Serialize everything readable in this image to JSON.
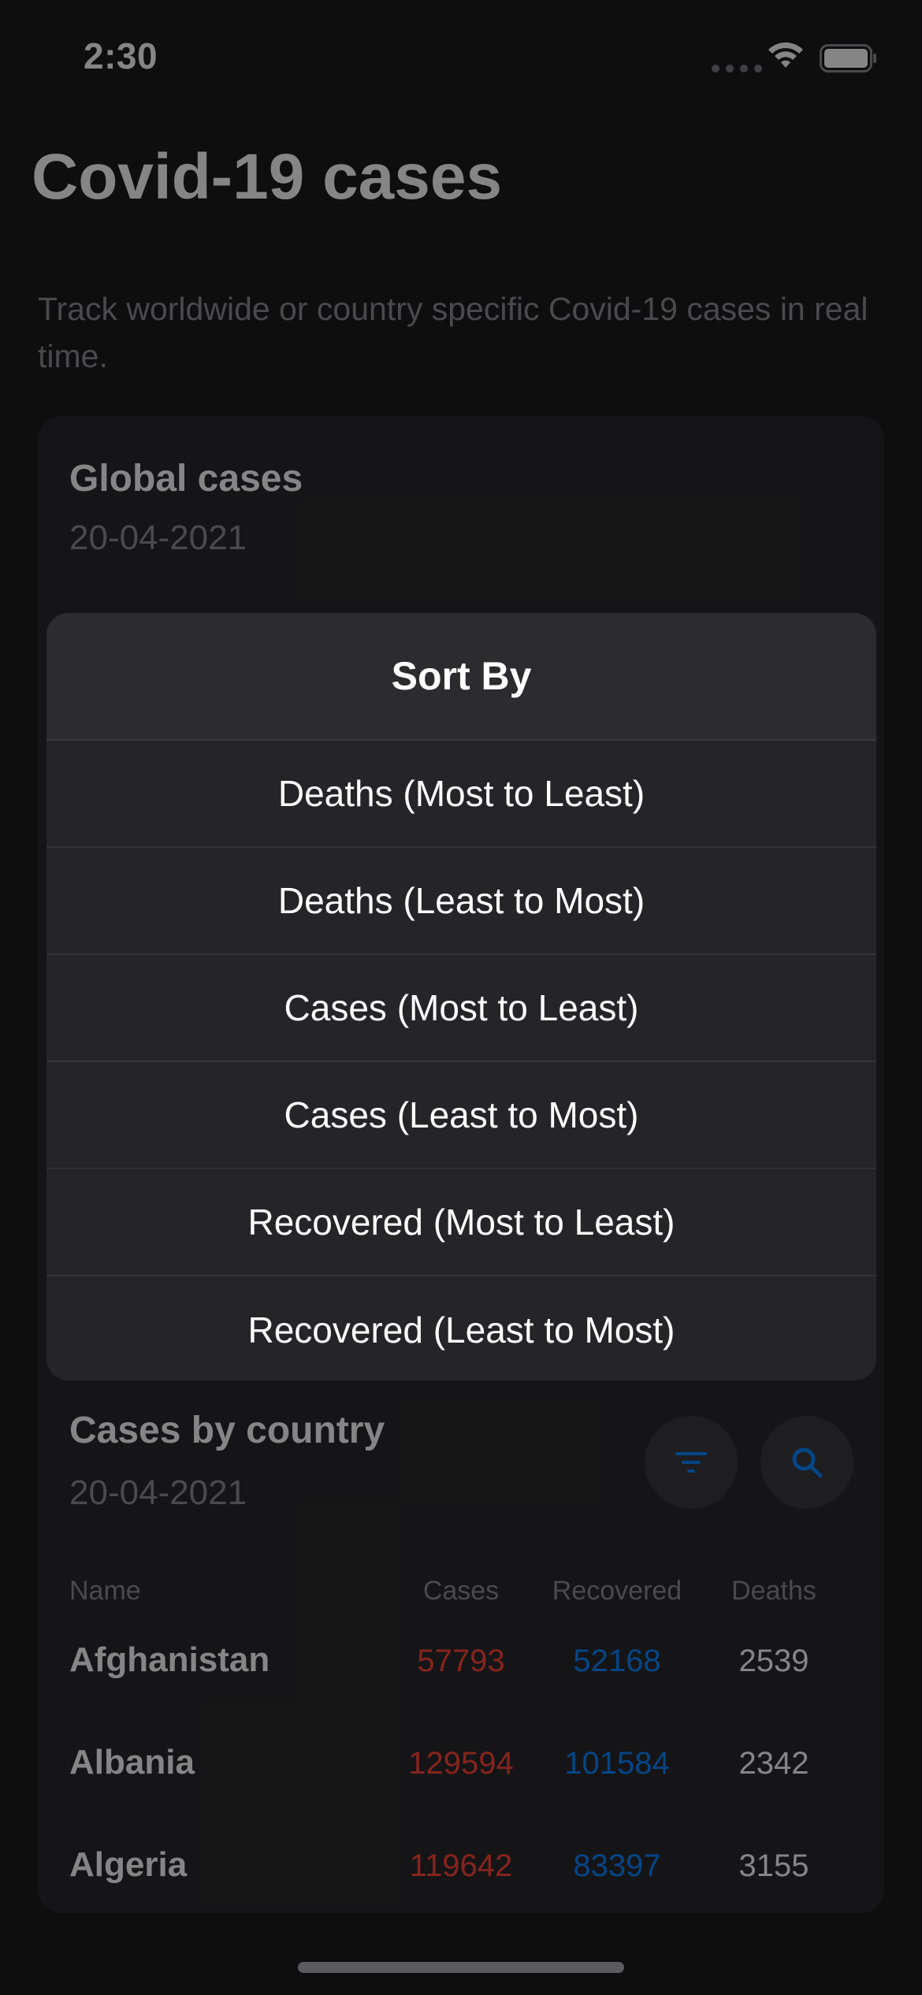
{
  "status_bar": {
    "time": "2:30",
    "icons": [
      "cellular-dots-icon",
      "wifi-icon",
      "battery-icon"
    ]
  },
  "header": {
    "title": "Covid-19 cases",
    "subtitle": "Track worldwide or country specific Covid-19 cases in real time."
  },
  "global_card": {
    "title": "Global cases",
    "date": "20-04-2021"
  },
  "country_card": {
    "title": "Cases by country",
    "date": "20-04-2021",
    "filter_icon": "filter-icon",
    "search_icon": "search-icon",
    "columns": {
      "name": "Name",
      "cases": "Cases",
      "recovered": "Recovered",
      "deaths": "Deaths"
    },
    "rows": [
      {
        "name": "Afghanistan",
        "cases": "57793",
        "recovered": "52168",
        "deaths": "2539"
      },
      {
        "name": "Albania",
        "cases": "129594",
        "recovered": "101584",
        "deaths": "2342"
      },
      {
        "name": "Algeria",
        "cases": "119642",
        "recovered": "83397",
        "deaths": "3155"
      }
    ]
  },
  "sort_sheet": {
    "title": "Sort By",
    "options": [
      "Deaths (Most to Least)",
      "Deaths (Least to Most)",
      "Cases (Most to Least)",
      "Cases (Least to Most)",
      "Recovered (Most to Least)",
      "Recovered (Least to Most)"
    ]
  },
  "colors": {
    "background": "#1b1b1d",
    "cases": "#ff453a",
    "recovered": "#0a84ff",
    "sheet": "#2c2c2e"
  }
}
